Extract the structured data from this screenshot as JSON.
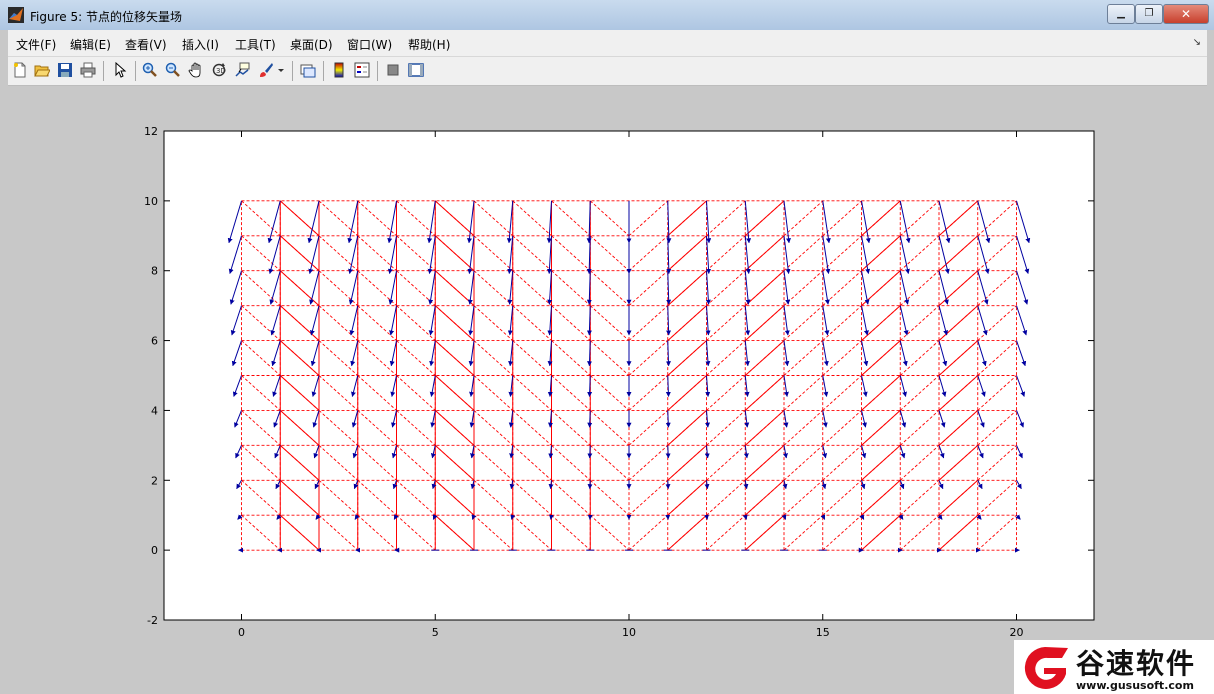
{
  "window": {
    "title": "Figure 5: 节点的位移矢量场",
    "min_glyph": "▁",
    "max_glyph": "❐",
    "close_glyph": "✕"
  },
  "menubar": {
    "items": [
      "文件(F)",
      "编辑(E)",
      "查看(V)",
      "插入(I)",
      "工具(T)",
      "桌面(D)",
      "窗口(W)",
      "帮助(H)"
    ],
    "corner_glyph": "↘"
  },
  "toolbar": {
    "buttons": [
      "new-figure",
      "open-file",
      "save-figure",
      "print-figure",
      "edit-plot",
      "zoom-in",
      "zoom-out",
      "pan",
      "rotate-3d",
      "data-cursor",
      "brush",
      "link-plot",
      "insert-colorbar",
      "insert-legend",
      "hide-plot-tools",
      "show-plot-tools"
    ]
  },
  "chart_data": {
    "type": "quiver",
    "title": "",
    "xlabel": "",
    "ylabel": "",
    "xlim": [
      -2,
      22
    ],
    "ylim": [
      -2,
      12
    ],
    "xticks": [
      0,
      5,
      10,
      15,
      20
    ],
    "yticks": [
      -2,
      0,
      2,
      4,
      6,
      8,
      10,
      12
    ],
    "grid": false,
    "mesh": {
      "x_nodes": [
        0,
        1,
        2,
        3,
        4,
        5,
        6,
        7,
        8,
        9,
        10,
        11,
        12,
        13,
        14,
        15,
        16,
        17,
        18,
        19,
        20
      ],
      "y_nodes": [
        0,
        1,
        2,
        3,
        4,
        5,
        6,
        7,
        8,
        9,
        10
      ],
      "color": "#ff0000",
      "style": "dashed",
      "diagonal_rule": "left half (x<10) diagonals run from top-left to bottom-right; right half (x>=10) run from bottom-left to top-right; lines appear solid where overlapping",
      "solid_segments_note": "visually solid diagonal bands and verticals appear in both halves"
    },
    "displacement": {
      "color": "#0000a0",
      "description": "arrow vectors at every mesh node; x-component antisymmetric about x=10 (nodes left of centre point left, right of centre point right), y-component downward growing with y",
      "x_amplitude_at_edge": 0.25,
      "y_amplitude_at_top": -1.2
    },
    "colors": {
      "axes_bg": "#ffffff",
      "figure_bg": "#c8c8c8"
    }
  },
  "watermark": {
    "brand_cn": "谷速软件",
    "url": "www.gususoft.com"
  }
}
